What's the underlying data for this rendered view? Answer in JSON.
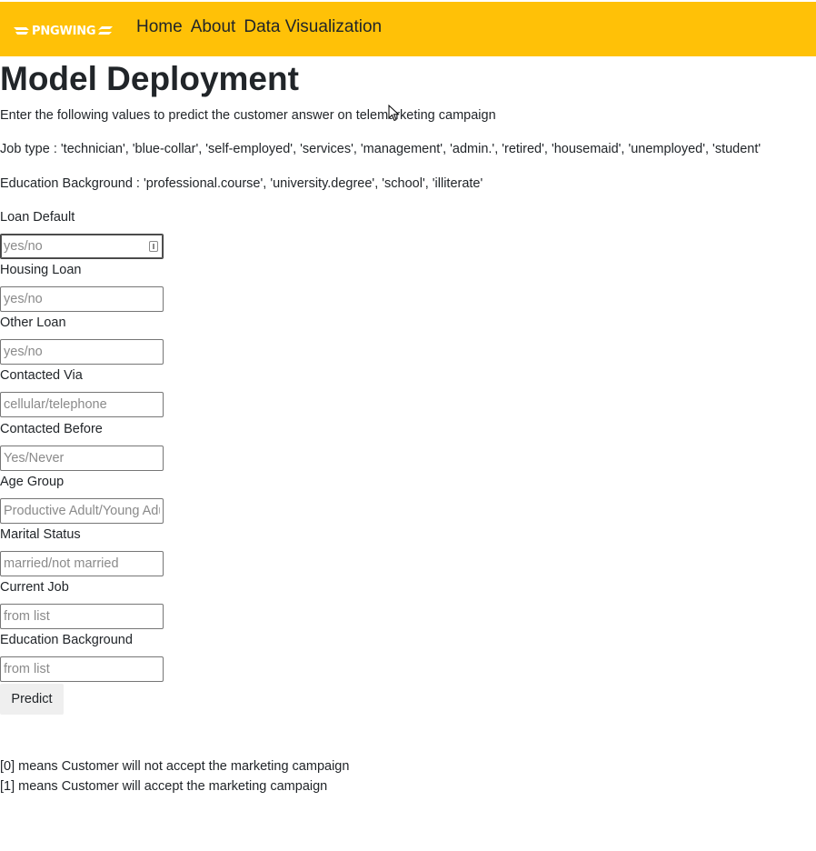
{
  "navbar": {
    "logo_text": "PNGWING",
    "links": [
      "Home",
      "About",
      "Data Visualization"
    ],
    "background": "#ffc107"
  },
  "page": {
    "title": "Model Deployment",
    "intro": "Enter the following values to predict the customer answer on telemarketing campaign",
    "job_type_text": "Job type : 'technician', 'blue-collar', 'self-employed', 'services', 'management', 'admin.', 'retired', 'housemaid', 'unemployed', 'student'",
    "education_text": "Education Background : 'professional.course', 'university.degree', 'school', 'illiterate'"
  },
  "form": {
    "fields": [
      {
        "label": "Loan Default",
        "placeholder": "yes/no",
        "value": ""
      },
      {
        "label": "Housing Loan",
        "placeholder": "yes/no",
        "value": ""
      },
      {
        "label": "Other Loan",
        "placeholder": "yes/no",
        "value": ""
      },
      {
        "label": "Contacted Via",
        "placeholder": "cellular/telephone",
        "value": ""
      },
      {
        "label": "Contacted Before",
        "placeholder": "Yes/Never",
        "value": ""
      },
      {
        "label": "Age Group",
        "placeholder": "Productive Adult/Young Adult",
        "value": ""
      },
      {
        "label": "Marital Status",
        "placeholder": "married/not married",
        "value": ""
      },
      {
        "label": "Current Job",
        "placeholder": "from list",
        "value": ""
      },
      {
        "label": "Education Background",
        "placeholder": "from list",
        "value": ""
      }
    ],
    "submit_label": "Predict"
  },
  "result_notes": [
    "[0] means Customer will not accept the marketing campaign",
    "[1] means Customer will accept the marketing campaign"
  ]
}
